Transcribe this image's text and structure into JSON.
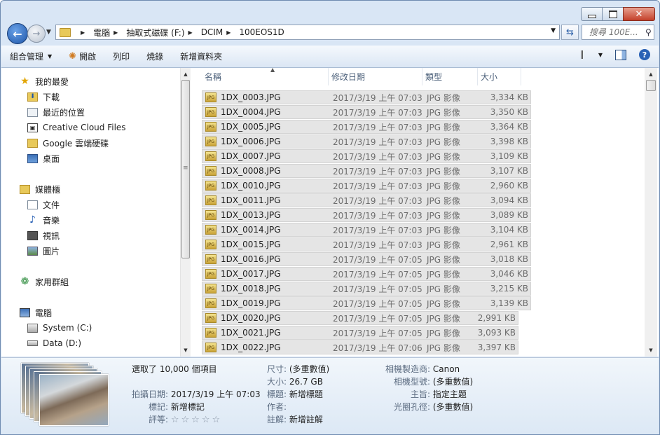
{
  "window": {
    "caption": {
      "minimize": "▭",
      "maximize": "▢",
      "close": "✕"
    }
  },
  "nav": {
    "breadcrumbs": [
      "電腦",
      "抽取式磁碟 (F:)",
      "DCIM",
      "100EOS1D"
    ],
    "search_placeholder": "搜尋 100E..."
  },
  "toolbar": {
    "organize": "組合管理",
    "open": "開啟",
    "print": "列印",
    "burn": "燒錄",
    "new_folder": "新增資料夾"
  },
  "navpane": {
    "favorites_header": "我的最愛",
    "favorites": [
      "下載",
      "最近的位置",
      "Creative Cloud Files",
      "Google 雲端硬碟",
      "桌面"
    ],
    "libraries_header": "媒體櫃",
    "libraries": [
      "文件",
      "音樂",
      "視訊",
      "圖片"
    ],
    "homegroup": "家用群組",
    "computer_header": "電腦",
    "drives": [
      "System (C:)",
      "Data (D:)"
    ]
  },
  "columns": {
    "name": "名稱",
    "modified": "修改日期",
    "type": "類型",
    "size": "大小"
  },
  "files": [
    {
      "name": "1DX_0003.JPG",
      "date": "2017/3/19 上午 07:03",
      "type": "JPG 影像",
      "size": "3,334 KB",
      "selected": true
    },
    {
      "name": "1DX_0004.JPG",
      "date": "2017/3/19 上午 07:03",
      "type": "JPG 影像",
      "size": "3,350 KB",
      "selected": true
    },
    {
      "name": "1DX_0005.JPG",
      "date": "2017/3/19 上午 07:03",
      "type": "JPG 影像",
      "size": "3,364 KB",
      "selected": true
    },
    {
      "name": "1DX_0006.JPG",
      "date": "2017/3/19 上午 07:03",
      "type": "JPG 影像",
      "size": "3,398 KB",
      "selected": true
    },
    {
      "name": "1DX_0007.JPG",
      "date": "2017/3/19 上午 07:03",
      "type": "JPG 影像",
      "size": "3,109 KB",
      "selected": true
    },
    {
      "name": "1DX_0008.JPG",
      "date": "2017/3/19 上午 07:03",
      "type": "JPG 影像",
      "size": "3,107 KB",
      "selected": true
    },
    {
      "name": "1DX_0010.JPG",
      "date": "2017/3/19 上午 07:03",
      "type": "JPG 影像",
      "size": "2,960 KB",
      "selected": true
    },
    {
      "name": "1DX_0011.JPG",
      "date": "2017/3/19 上午 07:03",
      "type": "JPG 影像",
      "size": "3,094 KB",
      "selected": true
    },
    {
      "name": "1DX_0013.JPG",
      "date": "2017/3/19 上午 07:03",
      "type": "JPG 影像",
      "size": "3,089 KB",
      "selected": true
    },
    {
      "name": "1DX_0014.JPG",
      "date": "2017/3/19 上午 07:03",
      "type": "JPG 影像",
      "size": "3,104 KB",
      "selected": true
    },
    {
      "name": "1DX_0015.JPG",
      "date": "2017/3/19 上午 07:03",
      "type": "JPG 影像",
      "size": "2,961 KB",
      "selected": true
    },
    {
      "name": "1DX_0016.JPG",
      "date": "2017/3/19 上午 07:05",
      "type": "JPG 影像",
      "size": "3,018 KB",
      "selected": true
    },
    {
      "name": "1DX_0017.JPG",
      "date": "2017/3/19 上午 07:05",
      "type": "JPG 影像",
      "size": "3,046 KB",
      "selected": true
    },
    {
      "name": "1DX_0018.JPG",
      "date": "2017/3/19 上午 07:05",
      "type": "JPG 影像",
      "size": "3,215 KB",
      "selected": true
    },
    {
      "name": "1DX_0019.JPG",
      "date": "2017/3/19 上午 07:05",
      "type": "JPG 影像",
      "size": "3,139 KB",
      "selected": true
    },
    {
      "name": "1DX_0020.JPG",
      "date": "2017/3/19 上午 07:05",
      "type": "JPG 影像",
      "size": "2,991 KB",
      "selected": true
    },
    {
      "name": "1DX_0021.JPG",
      "date": "2017/3/19 上午 07:05",
      "type": "JPG 影像",
      "size": "3,093 KB",
      "selected": true
    },
    {
      "name": "1DX_0022.JPG",
      "date": "2017/3/19 上午 07:06",
      "type": "JPG 影像",
      "size": "3,397 KB",
      "selected": true
    }
  ],
  "details": {
    "selected_count": "選取了 10,000 個項目",
    "date_taken_label": "拍攝日期:",
    "date_taken": "2017/3/19 上午 07:03",
    "tags_label": "標記:",
    "tags": "新增標記",
    "rating_label": "評等:",
    "rating_stars": "☆☆☆☆☆",
    "dims_label": "尺寸:",
    "dims": "(多重數值)",
    "size_label": "大小:",
    "size": "26.7 GB",
    "title_label": "標題:",
    "title": "新增標題",
    "author_label": "作者:",
    "author": "",
    "comment_label": "註解:",
    "comment": "新增註解",
    "maker_label": "相機製造商:",
    "maker": "Canon",
    "model_label": "相機型號:",
    "model": "(多重數值)",
    "subject_label": "主旨:",
    "subject": "指定主題",
    "fstop_label": "光圈孔徑:",
    "fstop": "(多重數值)"
  }
}
